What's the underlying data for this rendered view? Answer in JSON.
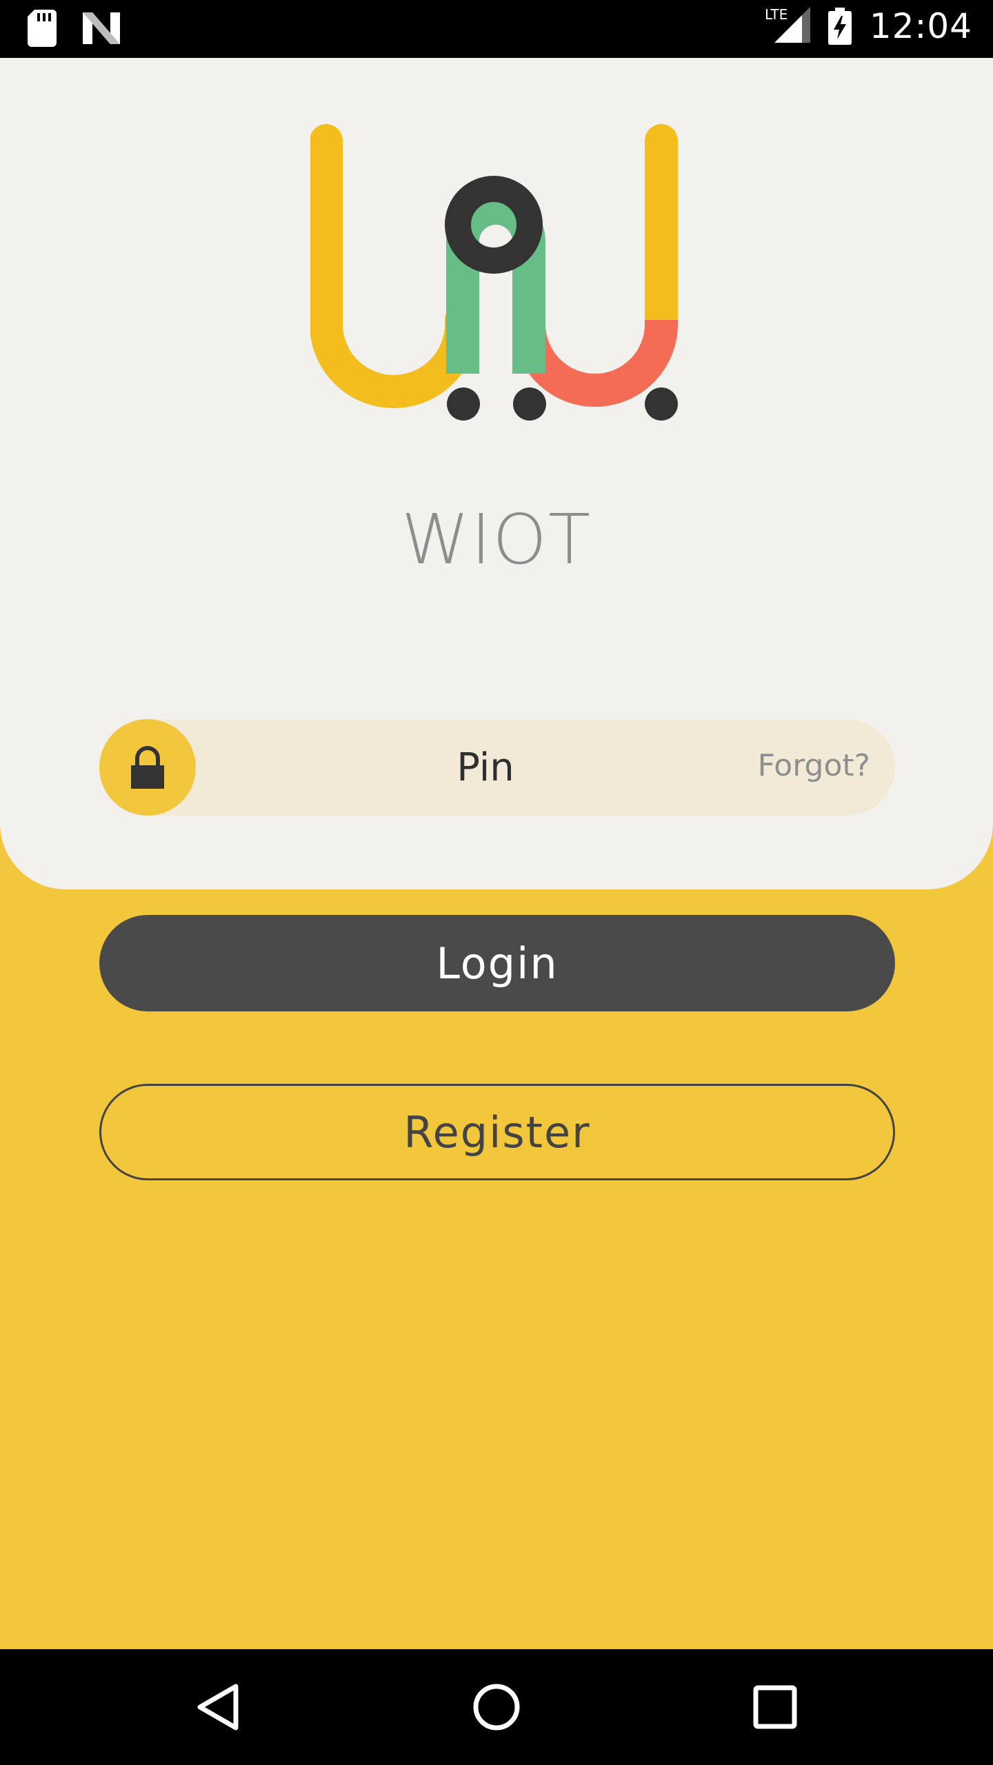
{
  "status_bar": {
    "time": "12:04",
    "network": "LTE",
    "icons": [
      "sd-card-icon",
      "n-logo-icon",
      "signal-icon",
      "battery-charging-icon"
    ]
  },
  "app": {
    "name": "WIOT",
    "logo_colors": {
      "yellow": "#f2bd1d",
      "dark": "#333333",
      "green": "#67bd86",
      "red": "#f46c56"
    }
  },
  "pin_field": {
    "placeholder": "Pin",
    "forgot_label": "Forgot?",
    "icon": "lock-icon"
  },
  "buttons": {
    "login_label": "Login",
    "register_label": "Register"
  },
  "nav_bar": {
    "icons": [
      "back-icon",
      "home-icon",
      "recents-icon"
    ]
  },
  "colors": {
    "accent": "#f3c73c",
    "card_background": "#f3f1ee",
    "field_background": "#f2ead7",
    "login_button": "#4a4a4a"
  }
}
